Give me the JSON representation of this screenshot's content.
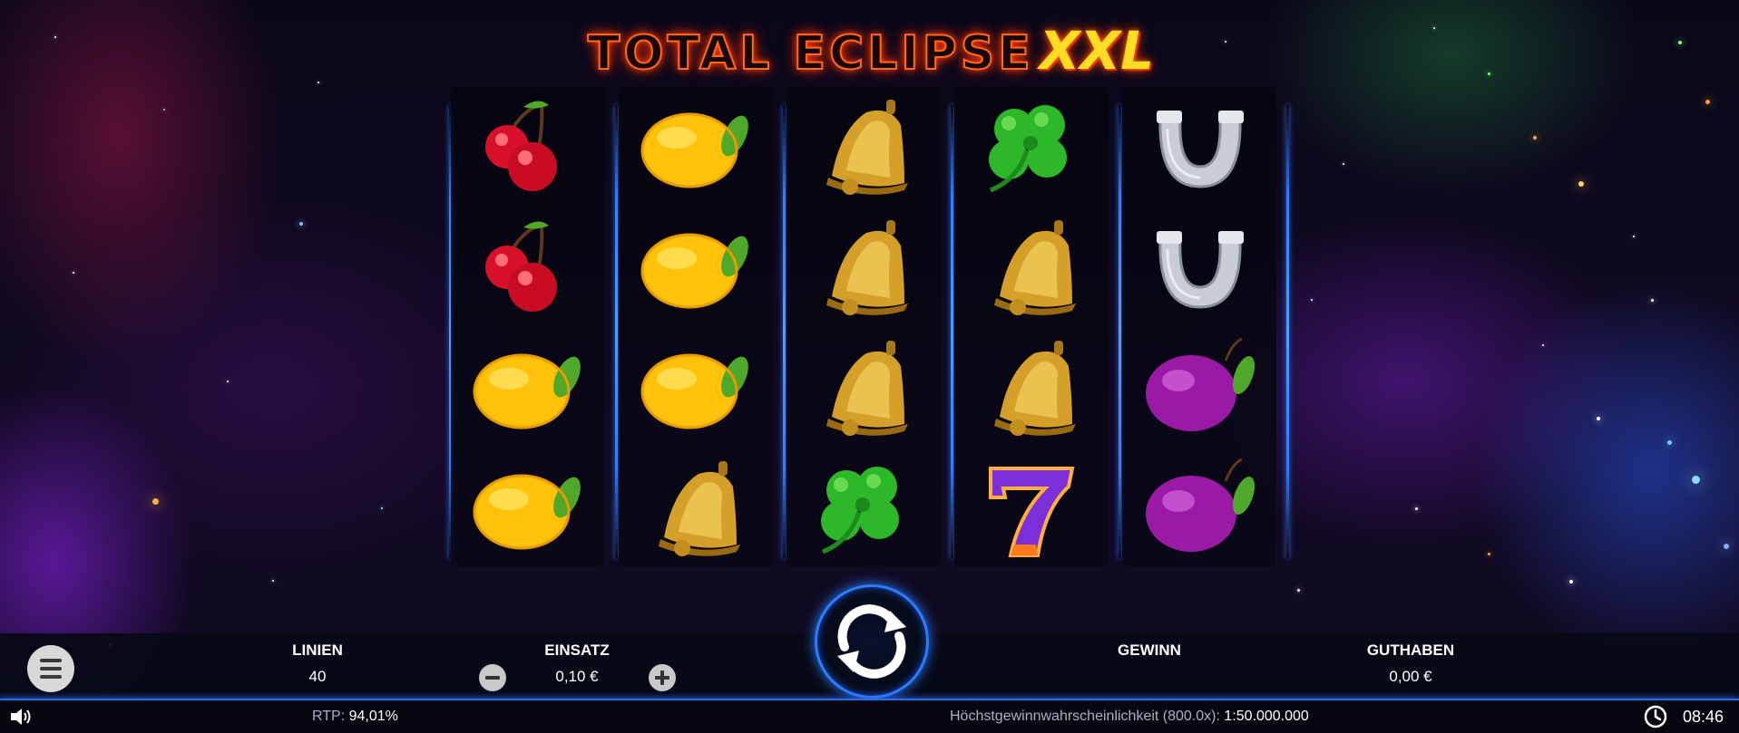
{
  "game": {
    "title_main": "TOTAL ECLIPSE",
    "title_suffix": "XXL"
  },
  "reels": [
    [
      "cherry",
      "cherry",
      "lemon",
      "lemon"
    ],
    [
      "lemon",
      "lemon",
      "lemon",
      "bell"
    ],
    [
      "bell",
      "bell",
      "bell",
      "clover"
    ],
    [
      "clover",
      "bell",
      "bell",
      "seven"
    ],
    [
      "horseshoe",
      "horseshoe",
      "plum",
      "plum"
    ]
  ],
  "controls": {
    "lines_label": "LINIEN",
    "lines_value": "40",
    "stake_label": "EINSATZ",
    "stake_value": "0,10 €",
    "win_label": "GEWINN",
    "balance_label": "GUTHABEN",
    "balance_value": "0,00 €",
    "menu_icon": "hamburger-menu-icon",
    "decrease_icon": "minus-icon",
    "increase_icon": "plus-icon",
    "spin_icon": "spin-arrows-icon"
  },
  "footer": {
    "rtp_label": "RTP:",
    "rtp_value": "94,01%",
    "max_win_label": "Höchstgewinnwahrscheinlichkeit (800.0x):",
    "max_win_value": "1:50.000.000",
    "time": "08:46",
    "sound_icon": "speaker-icon",
    "clock_icon": "clock-icon"
  },
  "colors": {
    "accent_blue": "#2a7dff",
    "title_orange": "#ff6a1a",
    "title_yellow": "#ffdd22"
  }
}
